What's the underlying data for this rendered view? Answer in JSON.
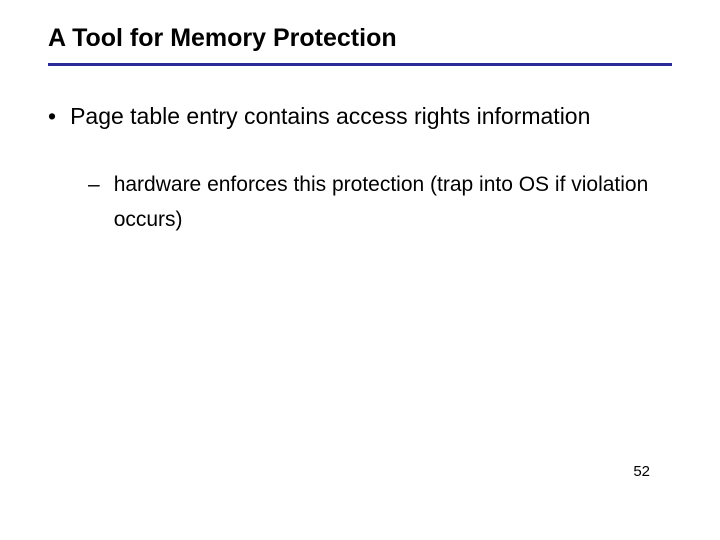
{
  "slide": {
    "title": "A Tool for Memory Protection",
    "bullets": {
      "b1": {
        "marker": "•",
        "text": "Page table entry contains access rights information"
      },
      "b2": {
        "marker": "–",
        "text": "hardware enforces this protection (trap into OS if violation occurs)"
      }
    },
    "page_number": "52"
  }
}
